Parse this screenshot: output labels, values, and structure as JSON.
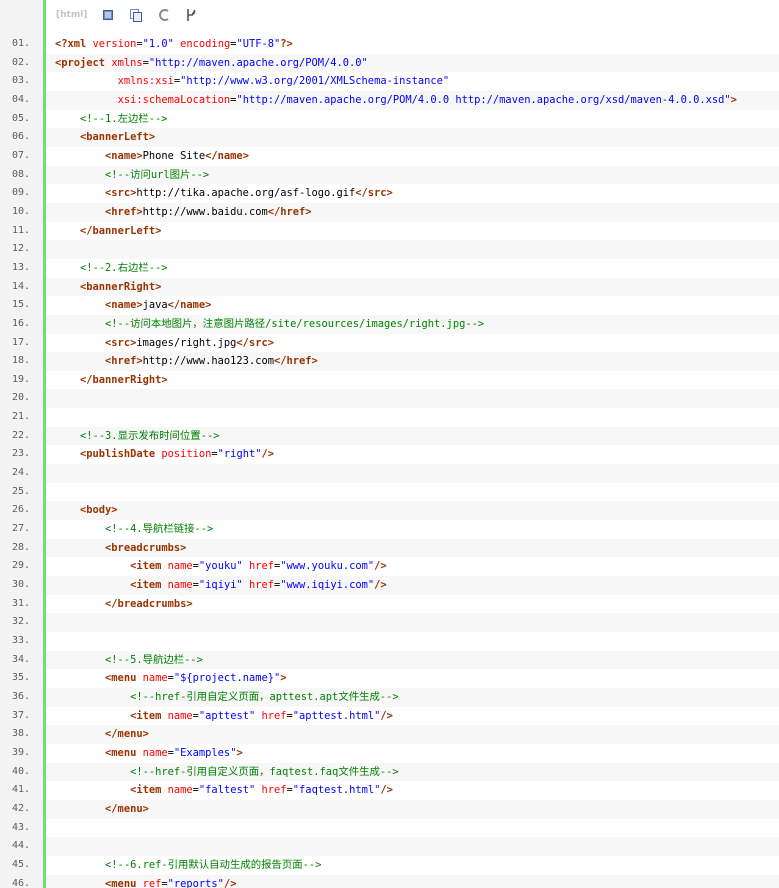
{
  "toolbar": {
    "language_label": "[html]",
    "buttons": [
      {
        "name": "view-source-icon"
      },
      {
        "name": "copy-icon"
      },
      {
        "name": "print-icon"
      },
      {
        "name": "about-icon"
      }
    ]
  },
  "colors": {
    "gutter_bar": "#6ce26c",
    "tag": "#993300",
    "attribute": "#ff0000",
    "value": "#0000ff",
    "comment": "#008200"
  },
  "code_lines": [
    {
      "num": "01.",
      "indent": "",
      "tokens": [
        [
          "tag",
          "<?xml "
        ],
        [
          "attr",
          "version"
        ],
        [
          "txt",
          "="
        ],
        [
          "val",
          "\"1.0\""
        ],
        [
          "txt",
          " "
        ],
        [
          "attr",
          "encoding"
        ],
        [
          "txt",
          "="
        ],
        [
          "val",
          "\"UTF-8\""
        ],
        [
          "tag",
          "?>"
        ]
      ]
    },
    {
      "num": "02.",
      "indent": "",
      "tokens": [
        [
          "tag",
          "<project "
        ],
        [
          "attr",
          "xmlns"
        ],
        [
          "txt",
          "="
        ],
        [
          "val",
          "\"http://maven.apache.org/POM/4.0.0\""
        ]
      ]
    },
    {
      "num": "03.",
      "indent": "          ",
      "tokens": [
        [
          "attr",
          "xmlns:xsi"
        ],
        [
          "txt",
          "="
        ],
        [
          "val",
          "\"http://www.w3.org/2001/XMLSchema-instance\""
        ]
      ]
    },
    {
      "num": "04.",
      "indent": "          ",
      "tokens": [
        [
          "attr",
          "xsi:schemaLocation"
        ],
        [
          "txt",
          "="
        ],
        [
          "val",
          "\"http://maven.apache.org/POM/4.0.0 http://maven.apache.org/xsd/maven-4.0.0.xsd\""
        ],
        [
          "tag",
          ">"
        ]
      ]
    },
    {
      "num": "05.",
      "indent": "    ",
      "tokens": [
        [
          "com",
          "<!--1.左边栏-->"
        ]
      ]
    },
    {
      "num": "06.",
      "indent": "    ",
      "tokens": [
        [
          "tag",
          "<bannerLeft>"
        ]
      ]
    },
    {
      "num": "07.",
      "indent": "        ",
      "tokens": [
        [
          "tag",
          "<name>"
        ],
        [
          "txt",
          "Phone Site"
        ],
        [
          "tag",
          "</name>"
        ]
      ]
    },
    {
      "num": "08.",
      "indent": "        ",
      "tokens": [
        [
          "com",
          "<!--访问url图片-->"
        ]
      ]
    },
    {
      "num": "09.",
      "indent": "        ",
      "tokens": [
        [
          "tag",
          "<src>"
        ],
        [
          "txt",
          "http://tika.apache.org/asf-logo.gif"
        ],
        [
          "tag",
          "</src>"
        ]
      ]
    },
    {
      "num": "10.",
      "indent": "        ",
      "tokens": [
        [
          "tag",
          "<href>"
        ],
        [
          "txt",
          "http://www.baidu.com"
        ],
        [
          "tag",
          "</href>"
        ]
      ]
    },
    {
      "num": "11.",
      "indent": "    ",
      "tokens": [
        [
          "tag",
          "</bannerLeft>"
        ]
      ]
    },
    {
      "num": "12.",
      "indent": "",
      "tokens": []
    },
    {
      "num": "13.",
      "indent": "    ",
      "tokens": [
        [
          "com",
          "<!--2.右边栏-->"
        ]
      ]
    },
    {
      "num": "14.",
      "indent": "    ",
      "tokens": [
        [
          "tag",
          "<bannerRight>"
        ]
      ]
    },
    {
      "num": "15.",
      "indent": "        ",
      "tokens": [
        [
          "tag",
          "<name>"
        ],
        [
          "txt",
          "java"
        ],
        [
          "tag",
          "</name>"
        ]
      ]
    },
    {
      "num": "16.",
      "indent": "        ",
      "tokens": [
        [
          "com",
          "<!--访问本地图片，注意图片路径/site/resources/images/right.jpg-->"
        ]
      ]
    },
    {
      "num": "17.",
      "indent": "        ",
      "tokens": [
        [
          "tag",
          "<src>"
        ],
        [
          "txt",
          "images/right.jpg"
        ],
        [
          "tag",
          "</src>"
        ]
      ]
    },
    {
      "num": "18.",
      "indent": "        ",
      "tokens": [
        [
          "tag",
          "<href>"
        ],
        [
          "txt",
          "http://www.hao123.com"
        ],
        [
          "tag",
          "</href>"
        ]
      ]
    },
    {
      "num": "19.",
      "indent": "    ",
      "tokens": [
        [
          "tag",
          "</bannerRight>"
        ]
      ]
    },
    {
      "num": "20.",
      "indent": "",
      "tokens": []
    },
    {
      "num": "21.",
      "indent": "",
      "tokens": []
    },
    {
      "num": "22.",
      "indent": "    ",
      "tokens": [
        [
          "com",
          "<!--3.显示发布时间位置-->"
        ]
      ]
    },
    {
      "num": "23.",
      "indent": "    ",
      "tokens": [
        [
          "tag",
          "<publishDate "
        ],
        [
          "attr",
          "position"
        ],
        [
          "txt",
          "="
        ],
        [
          "val",
          "\"right\""
        ],
        [
          "tag",
          "/>"
        ]
      ]
    },
    {
      "num": "24.",
      "indent": "",
      "tokens": []
    },
    {
      "num": "25.",
      "indent": "",
      "tokens": []
    },
    {
      "num": "26.",
      "indent": "    ",
      "tokens": [
        [
          "tag",
          "<body>"
        ]
      ]
    },
    {
      "num": "27.",
      "indent": "        ",
      "tokens": [
        [
          "com",
          "<!--4.导航栏链接-->"
        ]
      ]
    },
    {
      "num": "28.",
      "indent": "        ",
      "tokens": [
        [
          "tag",
          "<breadcrumbs>"
        ]
      ]
    },
    {
      "num": "29.",
      "indent": "            ",
      "tokens": [
        [
          "tag",
          "<item "
        ],
        [
          "attr",
          "name"
        ],
        [
          "txt",
          "="
        ],
        [
          "val",
          "\"youku\""
        ],
        [
          "txt",
          " "
        ],
        [
          "attr",
          "href"
        ],
        [
          "txt",
          "="
        ],
        [
          "val",
          "\"www.youku.com\""
        ],
        [
          "tag",
          "/>"
        ]
      ]
    },
    {
      "num": "30.",
      "indent": "            ",
      "tokens": [
        [
          "tag",
          "<item "
        ],
        [
          "attr",
          "name"
        ],
        [
          "txt",
          "="
        ],
        [
          "val",
          "\"iqiyi\""
        ],
        [
          "txt",
          " "
        ],
        [
          "attr",
          "href"
        ],
        [
          "txt",
          "="
        ],
        [
          "val",
          "\"www.iqiyi.com\""
        ],
        [
          "tag",
          "/>"
        ]
      ]
    },
    {
      "num": "31.",
      "indent": "        ",
      "tokens": [
        [
          "tag",
          "</breadcrumbs>"
        ]
      ]
    },
    {
      "num": "32.",
      "indent": "",
      "tokens": []
    },
    {
      "num": "33.",
      "indent": "",
      "tokens": []
    },
    {
      "num": "34.",
      "indent": "        ",
      "tokens": [
        [
          "com",
          "<!--5.导航边栏-->"
        ]
      ]
    },
    {
      "num": "35.",
      "indent": "        ",
      "tokens": [
        [
          "tag",
          "<menu "
        ],
        [
          "attr",
          "name"
        ],
        [
          "txt",
          "="
        ],
        [
          "val",
          "\"${project.name}\""
        ],
        [
          "tag",
          ">"
        ]
      ]
    },
    {
      "num": "36.",
      "indent": "            ",
      "tokens": [
        [
          "com",
          "<!--href-引用自定义页面，apttest.apt文件生成-->"
        ]
      ]
    },
    {
      "num": "37.",
      "indent": "            ",
      "tokens": [
        [
          "tag",
          "<item "
        ],
        [
          "attr",
          "name"
        ],
        [
          "txt",
          "="
        ],
        [
          "val",
          "\"apttest\""
        ],
        [
          "txt",
          " "
        ],
        [
          "attr",
          "href"
        ],
        [
          "txt",
          "="
        ],
        [
          "val",
          "\"apttest.html\""
        ],
        [
          "tag",
          "/>"
        ]
      ]
    },
    {
      "num": "38.",
      "indent": "        ",
      "tokens": [
        [
          "tag",
          "</menu>"
        ]
      ]
    },
    {
      "num": "39.",
      "indent": "        ",
      "tokens": [
        [
          "tag",
          "<menu "
        ],
        [
          "attr",
          "name"
        ],
        [
          "txt",
          "="
        ],
        [
          "val",
          "\"Examples\""
        ],
        [
          "tag",
          ">"
        ]
      ]
    },
    {
      "num": "40.",
      "indent": "            ",
      "tokens": [
        [
          "com",
          "<!--href-引用自定义页面，faqtest.faq文件生成-->"
        ]
      ]
    },
    {
      "num": "41.",
      "indent": "            ",
      "tokens": [
        [
          "tag",
          "<item "
        ],
        [
          "attr",
          "name"
        ],
        [
          "txt",
          "="
        ],
        [
          "val",
          "\"faltest\""
        ],
        [
          "txt",
          " "
        ],
        [
          "attr",
          "href"
        ],
        [
          "txt",
          "="
        ],
        [
          "val",
          "\"faqtest.html\""
        ],
        [
          "tag",
          "/>"
        ]
      ]
    },
    {
      "num": "42.",
      "indent": "        ",
      "tokens": [
        [
          "tag",
          "</menu>"
        ]
      ]
    },
    {
      "num": "43.",
      "indent": "",
      "tokens": []
    },
    {
      "num": "44.",
      "indent": "",
      "tokens": []
    },
    {
      "num": "45.",
      "indent": "        ",
      "tokens": [
        [
          "com",
          "<!--6.ref-引用默认自动生成的报告页面-->"
        ]
      ]
    },
    {
      "num": "46.",
      "indent": "        ",
      "tokens": [
        [
          "tag",
          "<menu "
        ],
        [
          "attr",
          "ref"
        ],
        [
          "txt",
          "="
        ],
        [
          "val",
          "\"reports\""
        ],
        [
          "tag",
          "/>"
        ]
      ]
    }
  ]
}
